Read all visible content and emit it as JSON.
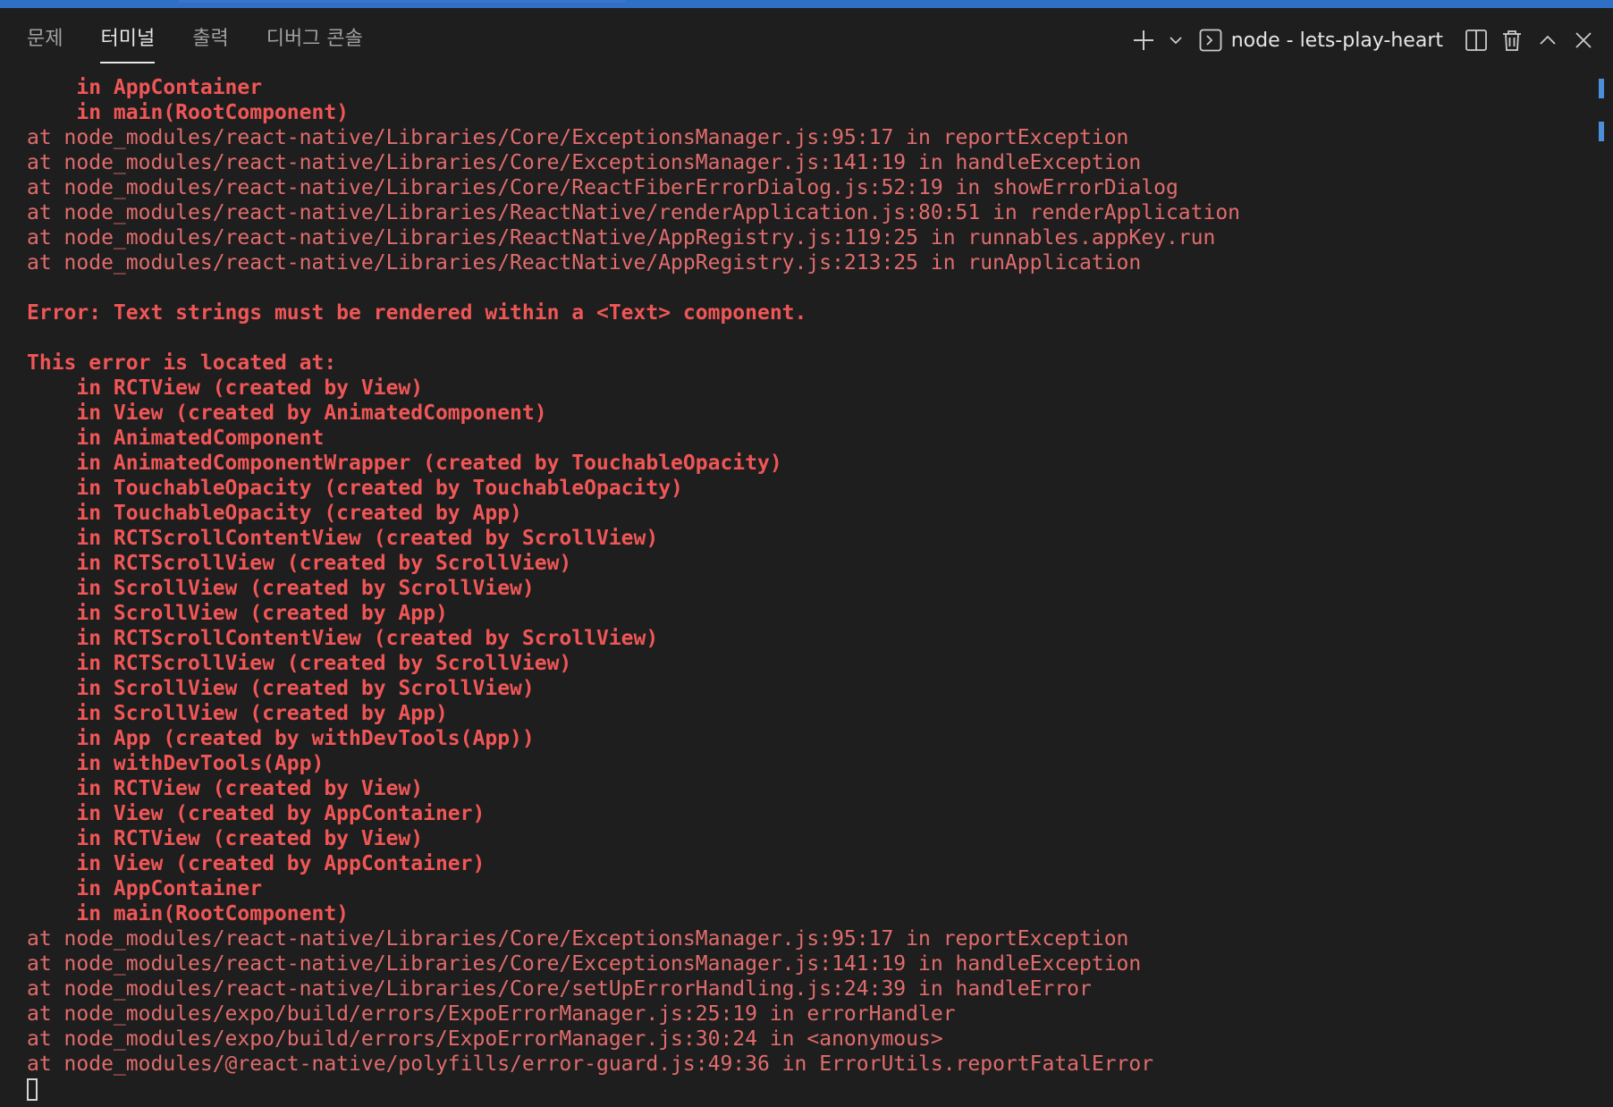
{
  "panel": {
    "tabs": [
      {
        "label": "문제"
      },
      {
        "label": "터미널"
      },
      {
        "label": "출력"
      },
      {
        "label": "디버그 콘솔"
      }
    ],
    "active_tab": "터미널",
    "terminal_title": "node - lets-play-heart"
  },
  "colors": {
    "accent": "#2f6fc6",
    "background": "#1e1e1e",
    "error_text": "#f05656",
    "stack_text": "#e06c6c"
  },
  "icons": [
    "plus-icon",
    "chevron-down-icon",
    "terminal-icon",
    "split-icon",
    "trash-icon",
    "chevron-up-icon",
    "close-icon"
  ],
  "terminal": {
    "lines": [
      {
        "type": "err",
        "text": "    in AppContainer"
      },
      {
        "type": "err",
        "text": "    in main(RootComponent)"
      },
      {
        "type": "at",
        "text": "at node_modules/react-native/Libraries/Core/ExceptionsManager.js:95:17 in reportException"
      },
      {
        "type": "at",
        "text": "at node_modules/react-native/Libraries/Core/ExceptionsManager.js:141:19 in handleException"
      },
      {
        "type": "at",
        "text": "at node_modules/react-native/Libraries/Core/ReactFiberErrorDialog.js:52:19 in showErrorDialog"
      },
      {
        "type": "at",
        "text": "at node_modules/react-native/Libraries/ReactNative/renderApplication.js:80:51 in renderApplication"
      },
      {
        "type": "at",
        "text": "at node_modules/react-native/Libraries/ReactNative/AppRegistry.js:119:25 in runnables.appKey.run"
      },
      {
        "type": "at",
        "text": "at node_modules/react-native/Libraries/ReactNative/AppRegistry.js:213:25 in runApplication"
      },
      {
        "type": "blank",
        "text": ""
      },
      {
        "type": "err",
        "text": "Error: Text strings must be rendered within a <Text> component."
      },
      {
        "type": "blank",
        "text": ""
      },
      {
        "type": "err",
        "text": "This error is located at:"
      },
      {
        "type": "err",
        "text": "    in RCTView (created by View)"
      },
      {
        "type": "err",
        "text": "    in View (created by AnimatedComponent)"
      },
      {
        "type": "err",
        "text": "    in AnimatedComponent"
      },
      {
        "type": "err",
        "text": "    in AnimatedComponentWrapper (created by TouchableOpacity)"
      },
      {
        "type": "err",
        "text": "    in TouchableOpacity (created by TouchableOpacity)"
      },
      {
        "type": "err",
        "text": "    in TouchableOpacity (created by App)"
      },
      {
        "type": "err",
        "text": "    in RCTScrollContentView (created by ScrollView)"
      },
      {
        "type": "err",
        "text": "    in RCTScrollView (created by ScrollView)"
      },
      {
        "type": "err",
        "text": "    in ScrollView (created by ScrollView)"
      },
      {
        "type": "err",
        "text": "    in ScrollView (created by App)"
      },
      {
        "type": "err",
        "text": "    in RCTScrollContentView (created by ScrollView)"
      },
      {
        "type": "err",
        "text": "    in RCTScrollView (created by ScrollView)"
      },
      {
        "type": "err",
        "text": "    in ScrollView (created by ScrollView)"
      },
      {
        "type": "err",
        "text": "    in ScrollView (created by App)"
      },
      {
        "type": "err",
        "text": "    in App (created by withDevTools(App))"
      },
      {
        "type": "err",
        "text": "    in withDevTools(App)"
      },
      {
        "type": "err",
        "text": "    in RCTView (created by View)"
      },
      {
        "type": "err",
        "text": "    in View (created by AppContainer)"
      },
      {
        "type": "err",
        "text": "    in RCTView (created by View)"
      },
      {
        "type": "err",
        "text": "    in View (created by AppContainer)"
      },
      {
        "type": "err",
        "text": "    in AppContainer"
      },
      {
        "type": "err",
        "text": "    in main(RootComponent)"
      },
      {
        "type": "at",
        "text": "at node_modules/react-native/Libraries/Core/ExceptionsManager.js:95:17 in reportException"
      },
      {
        "type": "at",
        "text": "at node_modules/react-native/Libraries/Core/ExceptionsManager.js:141:19 in handleException"
      },
      {
        "type": "at",
        "text": "at node_modules/react-native/Libraries/Core/setUpErrorHandling.js:24:39 in handleError"
      },
      {
        "type": "at",
        "text": "at node_modules/expo/build/errors/ExpoErrorManager.js:25:19 in errorHandler"
      },
      {
        "type": "at",
        "text": "at node_modules/expo/build/errors/ExpoErrorManager.js:30:24 in <anonymous>"
      },
      {
        "type": "at",
        "text": "at node_modules/@react-native/polyfills/error-guard.js:49:36 in ErrorUtils.reportFatalError"
      }
    ]
  }
}
